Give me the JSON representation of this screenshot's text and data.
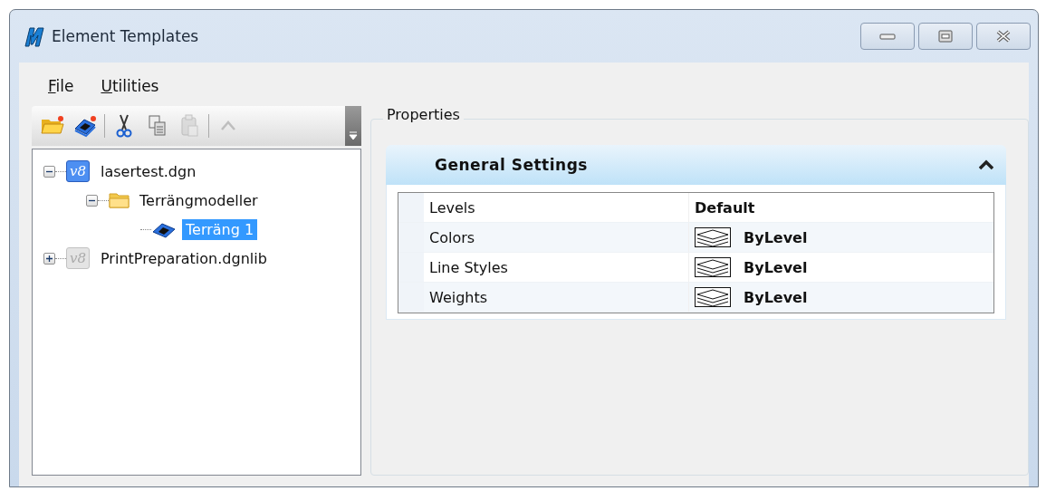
{
  "window": {
    "title": "Element Templates"
  },
  "menu": [
    {
      "label": "File"
    },
    {
      "label": "Utilities"
    }
  ],
  "toolbar": [
    {
      "kind": "open",
      "disabled": false
    },
    {
      "kind": "template",
      "disabled": false
    },
    {
      "kind": "separator"
    },
    {
      "kind": "cut",
      "disabled": false
    },
    {
      "kind": "copy",
      "disabled": false
    },
    {
      "kind": "paste",
      "disabled": true
    },
    {
      "kind": "separator"
    },
    {
      "kind": "up",
      "disabled": true
    }
  ],
  "tree": [
    {
      "label": "lasertest.dgn",
      "kind": "file",
      "badge": "v8",
      "expanded": true,
      "selected": false,
      "children": [
        {
          "label": "Terrängmodeller",
          "kind": "folder",
          "expanded": true,
          "selected": false,
          "children": [
            {
              "label": "Terräng 1",
              "kind": "template",
              "selected": true
            }
          ]
        }
      ]
    },
    {
      "label": "PrintPreparation.dgnlib",
      "kind": "library",
      "badge": "v8",
      "expanded": false,
      "selected": false
    }
  ],
  "properties": {
    "title": "Properties",
    "section": {
      "title": "General Settings",
      "expanded": true
    },
    "rows": [
      {
        "label": "Levels",
        "value": "Default",
        "kind": "text"
      },
      {
        "label": "Colors",
        "value": "ByLevel",
        "kind": "symbol"
      },
      {
        "label": "Line Styles",
        "value": "ByLevel",
        "kind": "symbol"
      },
      {
        "label": "Weights",
        "value": "ByLevel",
        "kind": "symbol"
      }
    ]
  }
}
